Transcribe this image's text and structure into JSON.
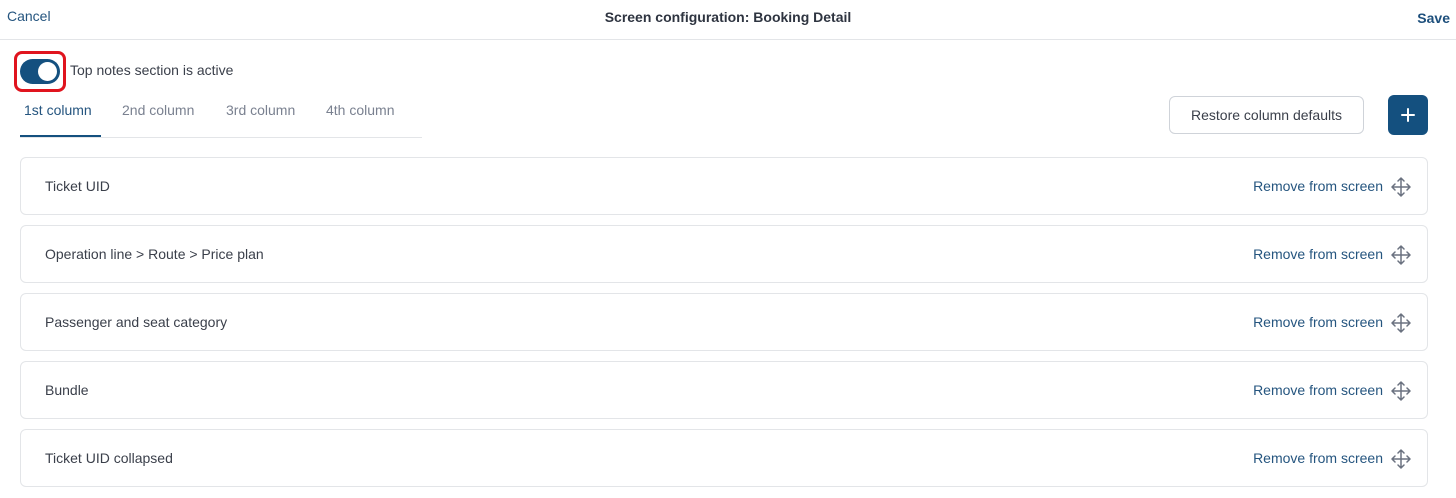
{
  "header": {
    "cancel_label": "Cancel",
    "title": "Screen configuration: Booking Detail",
    "save_label": "Save"
  },
  "toggle": {
    "label": "Top notes section is active",
    "state": "on"
  },
  "tabs": [
    {
      "label": "1st column",
      "active": true
    },
    {
      "label": "2nd column",
      "active": false
    },
    {
      "label": "3rd column",
      "active": false
    },
    {
      "label": "4th column",
      "active": false
    }
  ],
  "actions": {
    "restore_label": "Restore column defaults",
    "add_icon": "plus-icon"
  },
  "fields": [
    {
      "label": "Ticket UID",
      "action": "Remove from screen"
    },
    {
      "label": "Operation line > Route > Price plan",
      "action": "Remove from screen"
    },
    {
      "label": "Passenger and seat category",
      "action": "Remove from screen"
    },
    {
      "label": "Bundle",
      "action": "Remove from screen"
    },
    {
      "label": "Ticket UID collapsed",
      "action": "Remove from screen"
    }
  ],
  "colors": {
    "accent": "#14507f",
    "highlight": "#e0141e"
  },
  "icons": {
    "drag": "move-icon",
    "add": "plus-icon"
  }
}
